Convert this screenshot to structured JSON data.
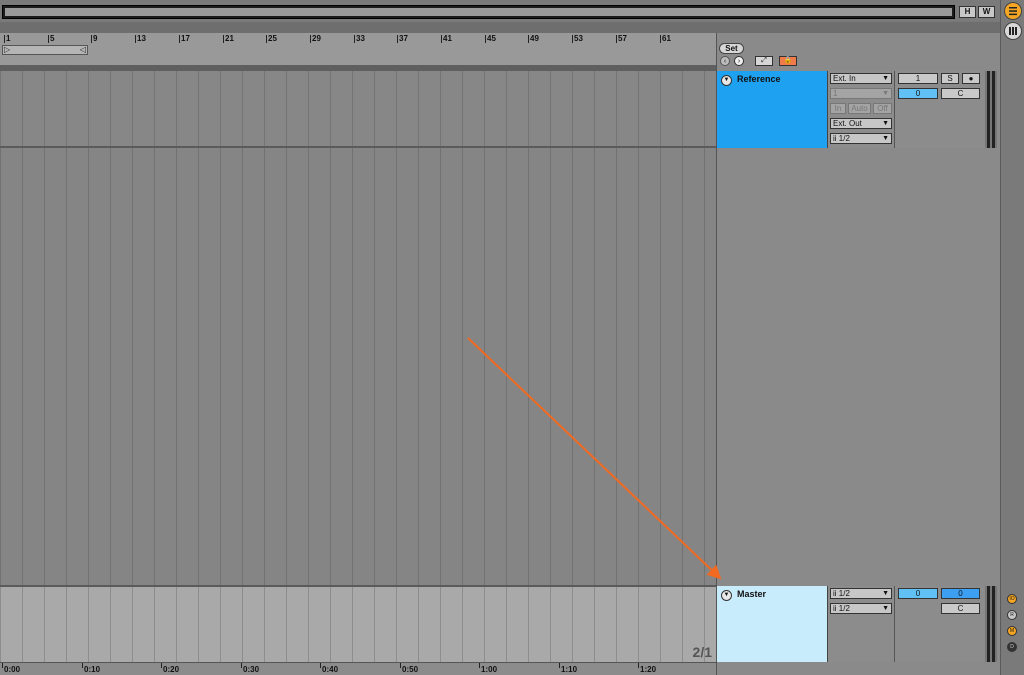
{
  "overview": {
    "h_label": "H",
    "w_label": "W"
  },
  "beat_ruler": {
    "labels": [
      "1",
      "5",
      "9",
      "13",
      "17",
      "21",
      "25",
      "29",
      "33",
      "37",
      "41",
      "45",
      "49",
      "53",
      "57",
      "61"
    ]
  },
  "time_ruler": {
    "labels": [
      "0:00",
      "0:10",
      "0:20",
      "0:30",
      "0:40",
      "0:50",
      "1:00",
      "1:10",
      "1:20"
    ]
  },
  "grid": {
    "fraction": "2/1"
  },
  "panel": {
    "set_label": "Set"
  },
  "reference_track": {
    "name": "Reference",
    "color": "#1ea1f0",
    "input_type": "Ext. In",
    "input_channel": "1",
    "monitor": {
      "in": "In",
      "auto": "Auto",
      "off": "Off"
    },
    "output_type": "Ext. Out",
    "output_channel": "ii 1/2",
    "track_number": "1",
    "solo_label": "S",
    "volume": "0",
    "pan": "C"
  },
  "master_track": {
    "name": "Master",
    "color": "#c9ecfd",
    "output_1": "ii 1/2",
    "output_2": "ii 1/2",
    "volume": "0",
    "cue_volume": "0",
    "pan": "C"
  },
  "rail": {
    "io_label": "IO",
    "r_label": "R",
    "m_label": "M",
    "d_label": "D"
  },
  "annotation": {
    "arrow_color": "#f26a21"
  }
}
